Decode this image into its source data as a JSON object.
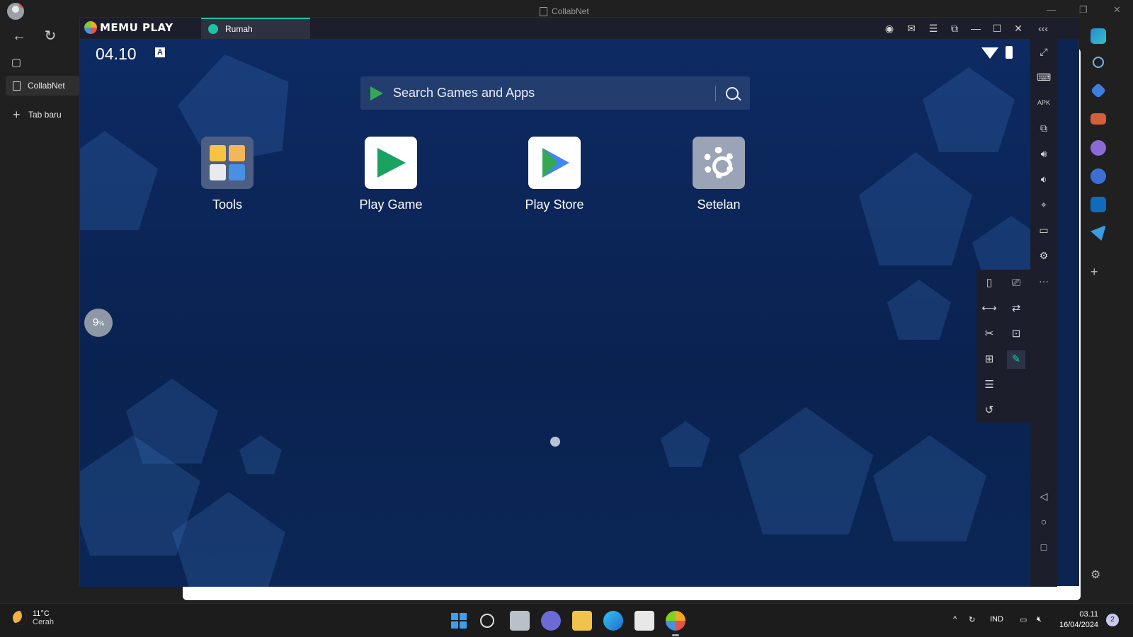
{
  "edge": {
    "window_title": "CollabNet",
    "tabs": [
      {
        "label": "CollabNet"
      },
      {
        "label": "Tab baru"
      }
    ]
  },
  "memu": {
    "brand": "MEMU PLAY",
    "tab_label": "Rumah"
  },
  "android": {
    "time": "04.10",
    "status_a": "A",
    "search_placeholder": "Search Games and Apps",
    "apps": [
      {
        "label": "Tools",
        "icon": "tools-folder-icon"
      },
      {
        "label": "Play Game",
        "icon": "play-games-icon"
      },
      {
        "label": "Play Store",
        "icon": "play-store-icon"
      },
      {
        "label": "Setelan",
        "icon": "settings-gear-icon"
      }
    ],
    "boost_value": "9",
    "boost_unit": "%"
  },
  "taskbar": {
    "weather_temp": "11°C",
    "weather_desc": "Cerah",
    "language": "IND",
    "clock_time": "03.11",
    "clock_date": "16/04/2024",
    "notification_count": "2"
  }
}
